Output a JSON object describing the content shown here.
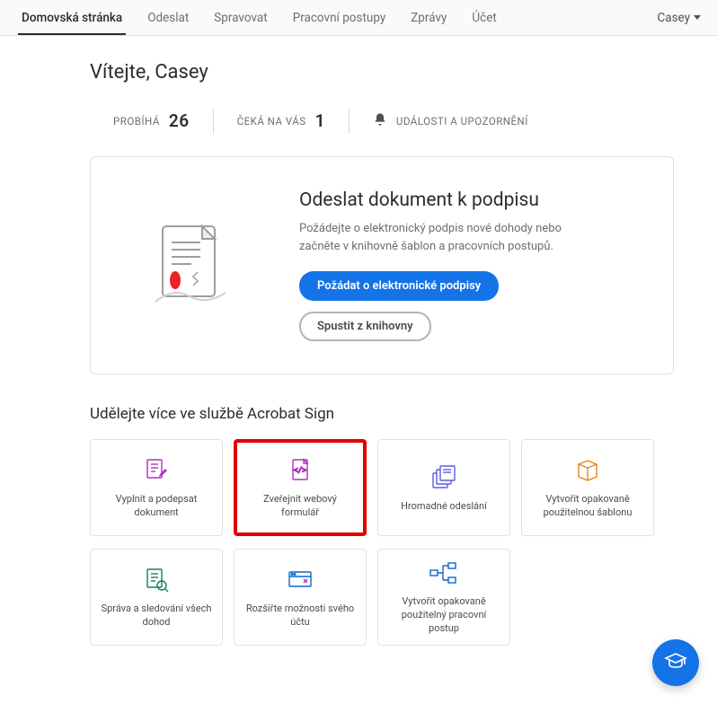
{
  "nav": {
    "tabs": [
      "Domovská stránka",
      "Odeslat",
      "Spravovat",
      "Pracovní postupy",
      "Zprávy",
      "Účet"
    ],
    "active_index": 0,
    "user_label": "Casey"
  },
  "welcome": "Vítejte, Casey",
  "stats": {
    "in_progress_label": "PROBÍHÁ",
    "in_progress_count": "26",
    "waiting_label": "ČEKÁ NA VÁS",
    "waiting_count": "1",
    "events_label": "UDÁLOSTI A UPOZORNĚNÍ"
  },
  "hero": {
    "title": "Odeslat dokument k podpisu",
    "desc": "Požádejte o elektronický podpis nové dohody nebo začněte v knihovně šablon a pracovních postupů.",
    "primary_btn": "Požádat o elektronické podpisy",
    "secondary_btn": "Spustit z knihovny"
  },
  "section_title": "Udělejte více ve službě Acrobat Sign",
  "cards": [
    {
      "label": "Vyplnit a podepsat dokument",
      "icon": "fill-sign",
      "highlighted": false
    },
    {
      "label": "Zveřejnit webový formulář",
      "icon": "web-form",
      "highlighted": true
    },
    {
      "label": "Hromadné odeslání",
      "icon": "bulk-send",
      "highlighted": false
    },
    {
      "label": "Vytvořit opakovaně použitelnou šablonu",
      "icon": "template",
      "highlighted": false
    },
    {
      "label": "Správa a sledování všech dohod",
      "icon": "track",
      "highlighted": false
    },
    {
      "label": "Rozšiřte možnosti svého účtu",
      "icon": "extend",
      "highlighted": false
    },
    {
      "label": "Vytvořit opakovaně použitelný pracovní postup",
      "icon": "workflow",
      "highlighted": false
    }
  ],
  "icons": {
    "fill-sign-color": "#b130bd",
    "web-form-color": "#b130bd",
    "bulk-send-color": "#5c5ce0",
    "template-color": "#e68619",
    "track-color": "#12805c",
    "extend-color": "#0d66d0",
    "workflow-color": "#0d66d0"
  }
}
